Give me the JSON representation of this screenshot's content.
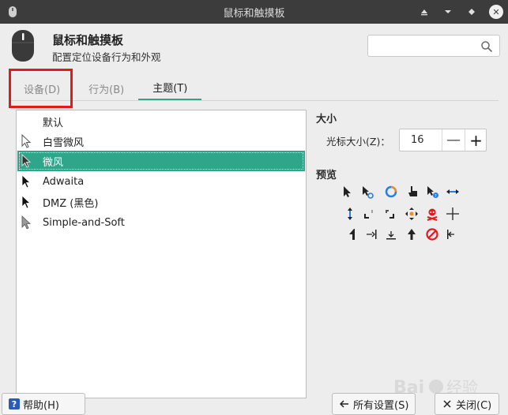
{
  "window": {
    "title": "鼠标和触摸板"
  },
  "header": {
    "title": "鼠标和触摸板",
    "subtitle": "配置定位设备行为和外观"
  },
  "search": {
    "placeholder": ""
  },
  "tabs": [
    {
      "label": "设备(D)",
      "active": false
    },
    {
      "label": "行为(B)",
      "active": false
    },
    {
      "label": "主题(T)",
      "active": true
    }
  ],
  "theme_list": [
    {
      "label": "默认",
      "icon": "none",
      "selected": false
    },
    {
      "label": "白雪微风",
      "icon": "white-arrow-cursor-icon",
      "selected": false
    },
    {
      "label": "微风",
      "icon": "dark-arrow-cursor-icon",
      "selected": true
    },
    {
      "label": "Adwaita",
      "icon": "black-arrow-cursor-icon",
      "selected": false
    },
    {
      "label": "DMZ (黑色)",
      "icon": "black-arrow-cursor-icon",
      "selected": false
    },
    {
      "label": "Simple-and-Soft",
      "icon": "gray-arrow-cursor-icon",
      "selected": false
    }
  ],
  "size": {
    "heading": "大小",
    "label": "光标大小(Z)：",
    "value": "16"
  },
  "preview": {
    "heading": "预览"
  },
  "buttons": {
    "help": "帮助(H)",
    "all_settings": "所有设置(S)",
    "close": "关闭(C)"
  },
  "colors": {
    "accent": "#2fa58a",
    "titlebar": "#3c3c3c",
    "annotation": "#e3191c"
  }
}
